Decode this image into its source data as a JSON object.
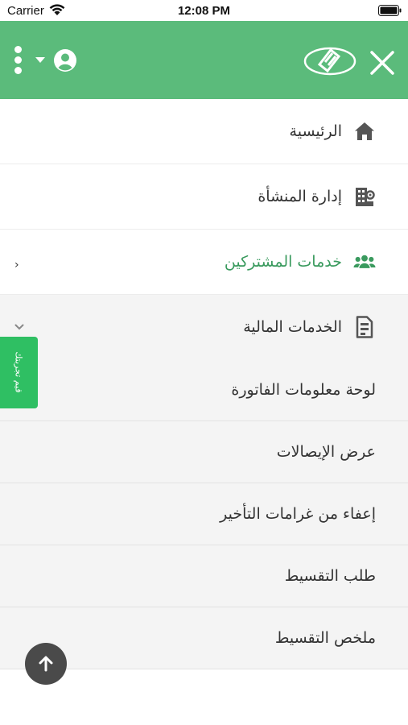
{
  "status_bar": {
    "carrier": "Carrier",
    "time": "12:08 PM"
  },
  "header": {
    "background": "#5bbb7b",
    "icons": [
      "kebab-menu-icon",
      "caret-down-icon",
      "user-circle-icon",
      "logo-icon",
      "close-icon"
    ]
  },
  "menu": {
    "items": [
      {
        "label": "الرئيسية",
        "icon": "home-icon",
        "active": false
      },
      {
        "label": "إدارة المنشأة",
        "icon": "building-gear-icon",
        "active": false
      },
      {
        "label": "خدمات المشتركين",
        "icon": "users-icon",
        "active": true,
        "indicator": "›"
      }
    ],
    "active_color": "#3a9a5e",
    "finance": {
      "label": "الخدمات المالية",
      "icon": "document-icon",
      "expanded": true,
      "sub_items": [
        {
          "label": "لوحة معلومات الفاتورة"
        },
        {
          "label": "عرض الإيصالات"
        },
        {
          "label": "إعفاء من غرامات التأخير"
        },
        {
          "label": "طلب التقسيط"
        },
        {
          "label": "ملخص التقسيط"
        }
      ]
    }
  },
  "feedback": {
    "label": "قيم تجربتك",
    "color": "#2fbf63"
  },
  "scroll_top": {
    "icon": "arrow-up-icon"
  }
}
